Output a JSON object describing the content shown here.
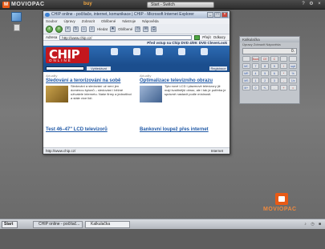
{
  "topbar": {
    "brand_logo": "M",
    "brand_name": "MOVIOPAC",
    "label": "buy",
    "active_window": "Start - Switch",
    "tray_icons": [
      "?",
      "⚙",
      "×"
    ]
  },
  "browser": {
    "title": "CHIP online - počítače, internet, komunikace | CHIP - Microsoft Internet Explorer",
    "window_buttons": [
      "_",
      "□",
      "×"
    ],
    "menu": [
      "Soubor",
      "Úpravy",
      "Zobrazit",
      "Oblíbené",
      "Nástroje",
      "Nápověda"
    ],
    "toolbar": {
      "back": "‹",
      "forward": "›",
      "search_label": "Hledat",
      "favorites_label": "Oblíbené"
    },
    "address_label": "Adresa",
    "address_value": "http://www.chip.cz/",
    "go_label": "Přejít",
    "links_label": "Odkazy",
    "status_url": "http://www.chip.cz/",
    "status_zone": "Internet"
  },
  "page": {
    "promo": "Před vstup na Chip DVD 4/09: DVD CleverLook",
    "logo_text": "CHIP",
    "logo_sub": "ONLINE",
    "nav": [
      "",
      "",
      "",
      "",
      ""
    ],
    "search_button": "Vyhledávat",
    "register_button": "Registrace",
    "left": {
      "section": "Aktuality",
      "headline": "Sledování a terorizování na sobě",
      "body": "Sledování a sledování už není jen doménou špionů – sledování i běžné užívatele internetu. Naše firmy a jednotlivci a stále více lidí."
    },
    "right": {
      "section": "Aktuality",
      "headline": "Optimalizace televizního obrazu",
      "body": "Tyto nové LCD i plazmové televizory již mají kvalitnější obraz, ale i tak je potřeba je správně nastavit podle místnosti."
    },
    "tail_left_headline": "Test 46–47\" LCD televizorů",
    "tail_right_headline": "Bankovní loupež přes internet"
  },
  "calculator": {
    "title": "Kalkulačka",
    "menu": "Úpravy  Zobrazit  Nápověda",
    "display": "0.",
    "keys": [
      "",
      "Back",
      "CE",
      "C",
      "",
      "",
      "MC",
      "7",
      "8",
      "9",
      "/",
      "sqrt",
      "MR",
      "4",
      "5",
      "6",
      "*",
      "%",
      "MS",
      "1",
      "2",
      "3",
      "-",
      "1/x",
      "M+",
      "0",
      "+/-",
      ".",
      "+",
      "="
    ]
  },
  "desktop_logo": "MOVIOPAC",
  "taskbar": {
    "start": "Start",
    "browser_task": "CHIP online - počítač...",
    "calc_task": "Kalkulačka",
    "tray": [
      "♪",
      "◷",
      "■"
    ]
  },
  "colors": {
    "brand_orange": "#e85a16",
    "chip_red": "#c4171e",
    "chip_blue": "#1b4e8e",
    "link_blue": "#1f58a6"
  }
}
